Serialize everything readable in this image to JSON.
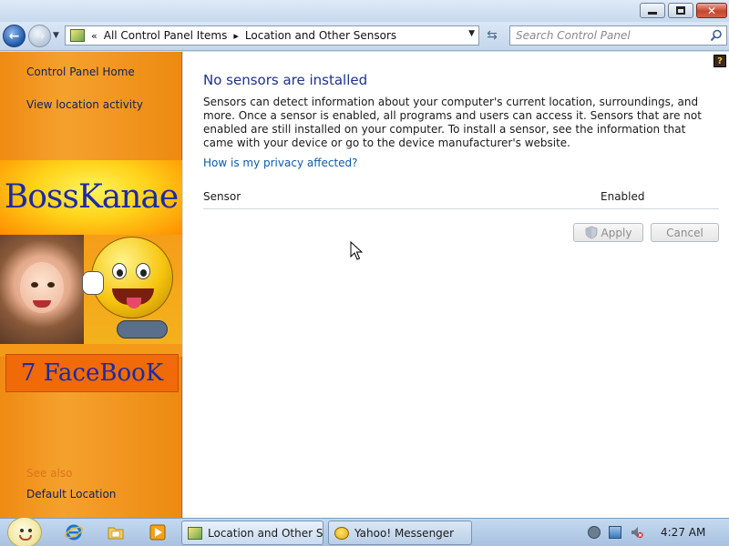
{
  "address_bar": {
    "breadcrumbs": [
      "All Control Panel Items",
      "Location and Other Sensors"
    ]
  },
  "search": {
    "placeholder": "Search Control Panel"
  },
  "left_pane": {
    "links": [
      "Control Panel Home",
      "View location activity"
    ],
    "see_also_label": "See also",
    "see_also_links": [
      "Default Location"
    ],
    "banner": {
      "title": "BossKanae",
      "subtitle": "7 FaceBooK"
    }
  },
  "main": {
    "heading": "No sensors are installed",
    "description": "Sensors can detect information about your computer's current location, surroundings, and more. Once a sensor is enabled, all programs and users can access it. Sensors that are not enabled are still installed on your computer. To install a sensor, see the information that came with your device or go to the device manufacturer's website.",
    "privacy_link": "How is my privacy affected?",
    "columns": [
      "Sensor",
      "Enabled"
    ],
    "buttons": {
      "apply": "Apply",
      "cancel": "Cancel"
    }
  },
  "taskbar": {
    "tasks": [
      "Location and Other S...",
      "Yahoo! Messenger"
    ],
    "clock": "4:27 AM"
  },
  "colors": {
    "link": "#0d5aa8",
    "heading": "#1e3287",
    "left_pane": "#f08a12"
  }
}
